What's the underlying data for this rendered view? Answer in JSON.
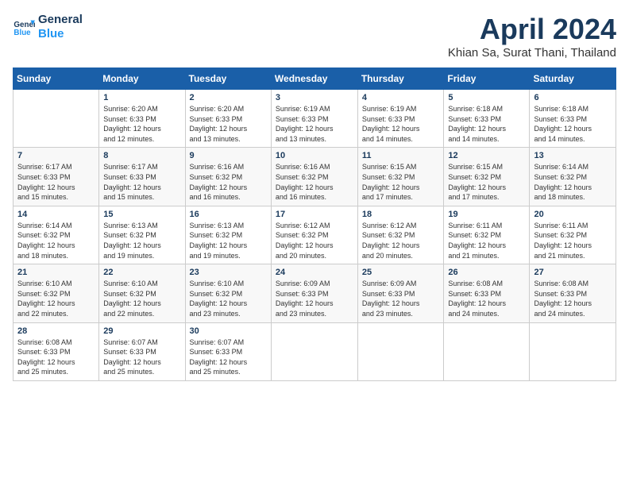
{
  "header": {
    "logo_line1": "General",
    "logo_line2": "Blue",
    "month_title": "April 2024",
    "location": "Khian Sa, Surat Thani, Thailand"
  },
  "weekdays": [
    "Sunday",
    "Monday",
    "Tuesday",
    "Wednesday",
    "Thursday",
    "Friday",
    "Saturday"
  ],
  "weeks": [
    [
      {
        "day": "",
        "info": ""
      },
      {
        "day": "1",
        "info": "Sunrise: 6:20 AM\nSunset: 6:33 PM\nDaylight: 12 hours\nand 12 minutes."
      },
      {
        "day": "2",
        "info": "Sunrise: 6:20 AM\nSunset: 6:33 PM\nDaylight: 12 hours\nand 13 minutes."
      },
      {
        "day": "3",
        "info": "Sunrise: 6:19 AM\nSunset: 6:33 PM\nDaylight: 12 hours\nand 13 minutes."
      },
      {
        "day": "4",
        "info": "Sunrise: 6:19 AM\nSunset: 6:33 PM\nDaylight: 12 hours\nand 14 minutes."
      },
      {
        "day": "5",
        "info": "Sunrise: 6:18 AM\nSunset: 6:33 PM\nDaylight: 12 hours\nand 14 minutes."
      },
      {
        "day": "6",
        "info": "Sunrise: 6:18 AM\nSunset: 6:33 PM\nDaylight: 12 hours\nand 14 minutes."
      }
    ],
    [
      {
        "day": "7",
        "info": "Sunrise: 6:17 AM\nSunset: 6:33 PM\nDaylight: 12 hours\nand 15 minutes."
      },
      {
        "day": "8",
        "info": "Sunrise: 6:17 AM\nSunset: 6:33 PM\nDaylight: 12 hours\nand 15 minutes."
      },
      {
        "day": "9",
        "info": "Sunrise: 6:16 AM\nSunset: 6:32 PM\nDaylight: 12 hours\nand 16 minutes."
      },
      {
        "day": "10",
        "info": "Sunrise: 6:16 AM\nSunset: 6:32 PM\nDaylight: 12 hours\nand 16 minutes."
      },
      {
        "day": "11",
        "info": "Sunrise: 6:15 AM\nSunset: 6:32 PM\nDaylight: 12 hours\nand 17 minutes."
      },
      {
        "day": "12",
        "info": "Sunrise: 6:15 AM\nSunset: 6:32 PM\nDaylight: 12 hours\nand 17 minutes."
      },
      {
        "day": "13",
        "info": "Sunrise: 6:14 AM\nSunset: 6:32 PM\nDaylight: 12 hours\nand 18 minutes."
      }
    ],
    [
      {
        "day": "14",
        "info": "Sunrise: 6:14 AM\nSunset: 6:32 PM\nDaylight: 12 hours\nand 18 minutes."
      },
      {
        "day": "15",
        "info": "Sunrise: 6:13 AM\nSunset: 6:32 PM\nDaylight: 12 hours\nand 19 minutes."
      },
      {
        "day": "16",
        "info": "Sunrise: 6:13 AM\nSunset: 6:32 PM\nDaylight: 12 hours\nand 19 minutes."
      },
      {
        "day": "17",
        "info": "Sunrise: 6:12 AM\nSunset: 6:32 PM\nDaylight: 12 hours\nand 20 minutes."
      },
      {
        "day": "18",
        "info": "Sunrise: 6:12 AM\nSunset: 6:32 PM\nDaylight: 12 hours\nand 20 minutes."
      },
      {
        "day": "19",
        "info": "Sunrise: 6:11 AM\nSunset: 6:32 PM\nDaylight: 12 hours\nand 21 minutes."
      },
      {
        "day": "20",
        "info": "Sunrise: 6:11 AM\nSunset: 6:32 PM\nDaylight: 12 hours\nand 21 minutes."
      }
    ],
    [
      {
        "day": "21",
        "info": "Sunrise: 6:10 AM\nSunset: 6:32 PM\nDaylight: 12 hours\nand 22 minutes."
      },
      {
        "day": "22",
        "info": "Sunrise: 6:10 AM\nSunset: 6:32 PM\nDaylight: 12 hours\nand 22 minutes."
      },
      {
        "day": "23",
        "info": "Sunrise: 6:10 AM\nSunset: 6:32 PM\nDaylight: 12 hours\nand 23 minutes."
      },
      {
        "day": "24",
        "info": "Sunrise: 6:09 AM\nSunset: 6:33 PM\nDaylight: 12 hours\nand 23 minutes."
      },
      {
        "day": "25",
        "info": "Sunrise: 6:09 AM\nSunset: 6:33 PM\nDaylight: 12 hours\nand 23 minutes."
      },
      {
        "day": "26",
        "info": "Sunrise: 6:08 AM\nSunset: 6:33 PM\nDaylight: 12 hours\nand 24 minutes."
      },
      {
        "day": "27",
        "info": "Sunrise: 6:08 AM\nSunset: 6:33 PM\nDaylight: 12 hours\nand 24 minutes."
      }
    ],
    [
      {
        "day": "28",
        "info": "Sunrise: 6:08 AM\nSunset: 6:33 PM\nDaylight: 12 hours\nand 25 minutes."
      },
      {
        "day": "29",
        "info": "Sunrise: 6:07 AM\nSunset: 6:33 PM\nDaylight: 12 hours\nand 25 minutes."
      },
      {
        "day": "30",
        "info": "Sunrise: 6:07 AM\nSunset: 6:33 PM\nDaylight: 12 hours\nand 25 minutes."
      },
      {
        "day": "",
        "info": ""
      },
      {
        "day": "",
        "info": ""
      },
      {
        "day": "",
        "info": ""
      },
      {
        "day": "",
        "info": ""
      }
    ]
  ]
}
